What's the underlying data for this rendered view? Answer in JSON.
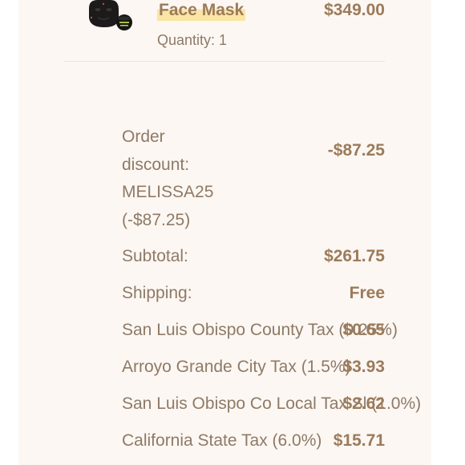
{
  "product": {
    "title": "Face Mask",
    "price": "$349.00",
    "quantity": "Quantity: 1",
    "image_icon": "face-mask-product-image"
  },
  "discount": {
    "label_lines": [
      "Order",
      "discount:",
      "MELISSA25",
      "(-$87.25)"
    ],
    "value": "-$87.25"
  },
  "summary": {
    "subtotal_label": "Subtotal:",
    "subtotal_value": "$261.75",
    "shipping_label": "Shipping:",
    "shipping_value": "Free",
    "taxes": [
      {
        "label": "San Luis Obispo County Tax (0.25%)",
        "value": "$0.65"
      },
      {
        "label": "Arroyo Grande City Tax (1.5%)",
        "value": "$3.93"
      },
      {
        "label": "San Luis Obispo Co Local Tax Sl (1.0%)",
        "value": "$2.62"
      },
      {
        "label": "California State Tax (6.0%)",
        "value": "$15.71"
      }
    ]
  },
  "colors": {
    "accent_text": "#9b7b5a",
    "body_text": "#8f7a66",
    "highlight": "#fbe5a5",
    "card_background": "#fcf7f3"
  }
}
